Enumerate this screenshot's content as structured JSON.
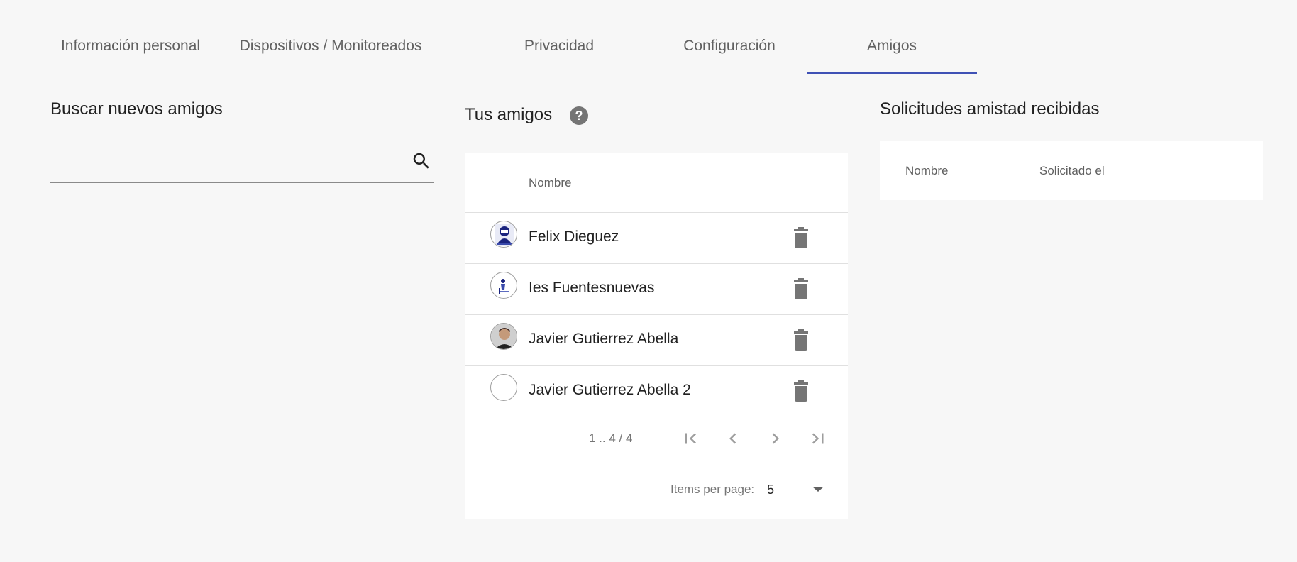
{
  "tabs": [
    {
      "label": "Información personal"
    },
    {
      "label": "Dispositivos / Monitoreados"
    },
    {
      "label": "Privacidad"
    },
    {
      "label": "Configuración"
    },
    {
      "label": "Amigos",
      "active": true
    }
  ],
  "search_section": {
    "title": "Buscar nuevos amigos",
    "input_value": "",
    "icon": "search-icon"
  },
  "friends_section": {
    "title": "Tus amigos",
    "help_icon": "?",
    "column_name": "Nombre",
    "rows": [
      {
        "name": "Felix Dieguez",
        "avatar": "cartoon-avatar"
      },
      {
        "name": "Ies Fuentesnuevas",
        "avatar": "logo-avatar"
      },
      {
        "name": "Javier Gutierrez Abella",
        "avatar": "photo-avatar"
      },
      {
        "name": "Javier Gutierrez Abella 2",
        "avatar": "empty-avatar"
      }
    ],
    "paginator": {
      "range": "1 .. 4 / 4",
      "items_per_page_label": "Items per page:",
      "items_per_page_value": "5"
    }
  },
  "requests_section": {
    "title": "Solicitudes amistad recibidas",
    "col_name": "Nombre",
    "col_date": "Solicitado el"
  },
  "colors": {
    "accent": "#3f51b5",
    "background": "#f7f7f7",
    "icon_gray": "#757575"
  }
}
